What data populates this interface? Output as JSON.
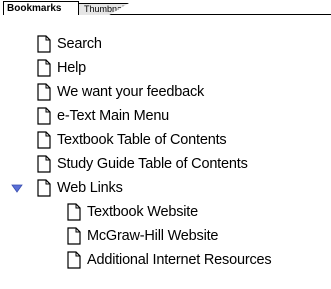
{
  "tabs": {
    "active_label": "Bookmarks",
    "inactive_label": "Thumbnails"
  },
  "bookmarks": {
    "items": [
      {
        "label": "Search"
      },
      {
        "label": "Help"
      },
      {
        "label": "We want your feedback"
      },
      {
        "label": "e-Text Main Menu"
      },
      {
        "label": "Textbook Table of Contents"
      },
      {
        "label": "Study Guide Table of Contents"
      },
      {
        "label": "Web Links",
        "expanded": true
      }
    ],
    "web_links_children": [
      {
        "label": "Textbook Website"
      },
      {
        "label": "McGraw-Hill Website"
      },
      {
        "label": "Additional Internet Resources"
      }
    ]
  },
  "icons": {
    "page": "page-icon",
    "expander": "triangle-down-icon"
  },
  "colors": {
    "expander": "#5a6fd6",
    "tab_inactive": "#e6e6e6"
  }
}
